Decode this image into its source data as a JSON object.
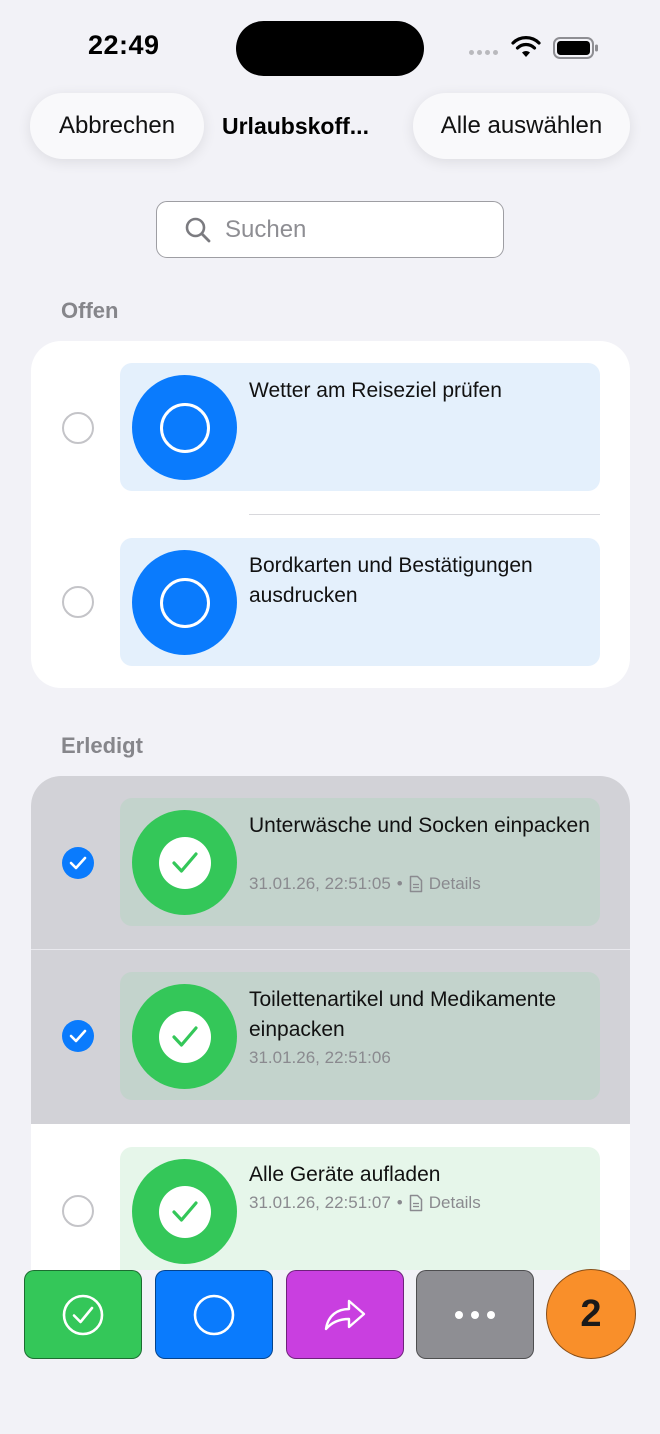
{
  "status_bar": {
    "time": "22:49"
  },
  "nav": {
    "cancel_label": "Abbrechen",
    "title": "Urlaubskoff...",
    "select_all_label": "Alle auswählen"
  },
  "search": {
    "placeholder": "Suchen"
  },
  "sections": {
    "open": {
      "header": "Offen",
      "items": [
        {
          "title": "Wetter am Reiseziel prüfen"
        },
        {
          "title": "Bordkarten und Bestätigungen ausdrucken"
        }
      ]
    },
    "done": {
      "header": "Erledigt",
      "items": [
        {
          "title": "Unterwäsche und Socken einpacken",
          "timestamp": "31.01.26, 22:51:05",
          "separator": "•",
          "details_label": "Details",
          "selected": true
        },
        {
          "title": "Toilettenartikel und Medikamente einpacken",
          "timestamp": "31.01.26, 22:51:06",
          "selected": true
        },
        {
          "title": "Alle Geräte aufladen",
          "timestamp": "31.01.26, 22:51:07",
          "separator": "•",
          "details_label": "Details",
          "selected": false
        }
      ]
    }
  },
  "toolbar": {
    "buttons": [
      {
        "icon": "checkmark-circle-icon",
        "color": "#34c759"
      },
      {
        "icon": "circle-icon",
        "color": "#0a7bfd"
      },
      {
        "icon": "share-arrow-icon",
        "color": "#c93fe0"
      },
      {
        "icon": "more-ellipsis-icon",
        "color": "#8e8e93"
      }
    ],
    "selected_count": "2",
    "count_color": "#f98f2a"
  },
  "colors": {
    "accent_blue": "#0a7bfd",
    "done_green": "#34c759",
    "background": "#f2f2f7"
  }
}
